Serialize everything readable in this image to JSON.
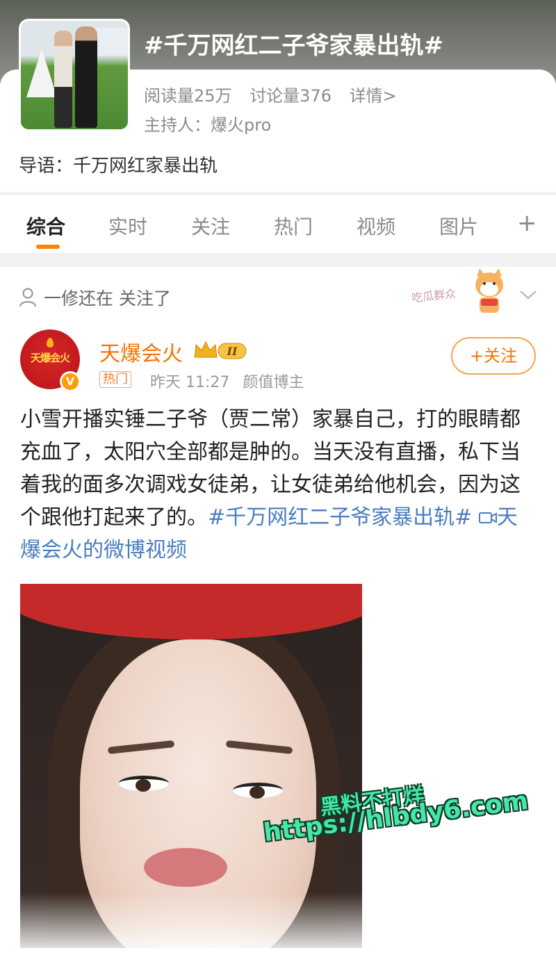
{
  "topic": {
    "title": "#千万网红二子爷家暴出轨#",
    "reads": "阅读量25万",
    "discussions": "讨论量376",
    "details_link": "详情>",
    "host": "主持人：爆火pro",
    "intro": "导语：千万网红家暴出轨"
  },
  "tabs": [
    {
      "label": "综合",
      "active": true
    },
    {
      "label": "实时"
    },
    {
      "label": "关注"
    },
    {
      "label": "热门"
    },
    {
      "label": "视频"
    },
    {
      "label": "图片"
    }
  ],
  "tab_plus": "+",
  "post": {
    "followed_by": "一修还在 关注了",
    "sticker_text": "吃瓜群众",
    "author": {
      "name": "天爆会火",
      "avatar_text": "天爆会火",
      "level": "II",
      "verified": "V"
    },
    "hot_badge": "热门",
    "time": "昨天 11:27",
    "category": "颜值博主",
    "follow_button": "+关注",
    "text": "小雪开播实锤二子爷（贾二常）家暴自己，打的眼睛都充血了，太阳穴全部都是肿的。当天没有直播，私下当着我的面多次调戏女徒弟，让女徒弟给他机会，因为这个跟他打起来了的。",
    "hashtag_link": "#千万网红二子爷家暴出轨#",
    "video_link": "天爆会火的微博视频"
  },
  "watermark": {
    "line1": "黑料不打烊",
    "line2": "https://hlbdy6.com"
  },
  "colors": {
    "accent": "#ff8200",
    "author_name": "#f77300",
    "link": "#4a7dbf",
    "watermark": "#44e8a6"
  }
}
